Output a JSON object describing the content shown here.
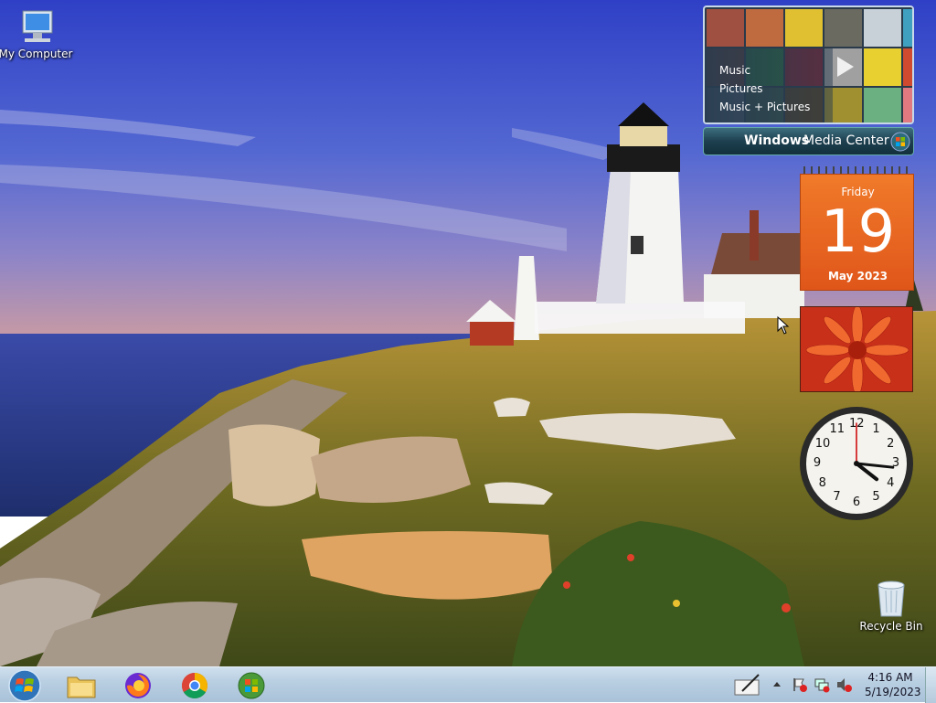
{
  "desktop": {
    "icons": [
      {
        "label": "My Computer"
      },
      {
        "label": "Recycle Bin"
      }
    ]
  },
  "gadgets": {
    "media_center": {
      "menu": [
        "Music",
        "Pictures",
        "Music + Pictures"
      ],
      "brand_bold": "Windows",
      "brand_light": "Media Center"
    },
    "calendar": {
      "weekday": "Friday",
      "day": "19",
      "month_year": "May 2023"
    },
    "clock": {
      "numerals": [
        "12",
        "1",
        "2",
        "3",
        "4",
        "5",
        "6",
        "7",
        "8",
        "9",
        "10",
        "11"
      ],
      "time": "4:16"
    }
  },
  "taskbar": {
    "pinned": [
      "start-button",
      "file-explorer",
      "firefox",
      "chrome",
      "windows-logo"
    ],
    "tray": {
      "time": "4:16 AM",
      "date": "5/19/2023"
    }
  },
  "colors": {
    "calendar_orange": "#e8611f",
    "taskbar": "#b9cfe2",
    "sky": "#3f56c9"
  }
}
